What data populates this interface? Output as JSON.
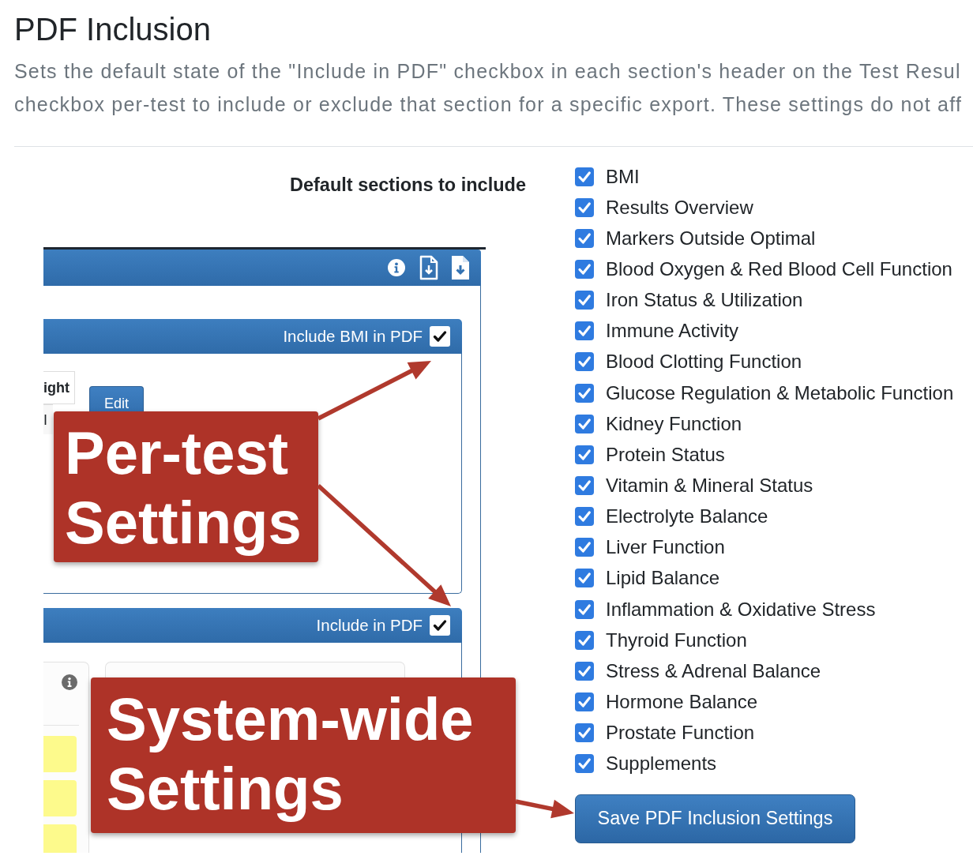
{
  "page": {
    "title": "PDF Inclusion",
    "description_lines": [
      "Sets the default state of the \"Include in PDF\" checkbox in each section's header on the Test Resul",
      "checkbox per-test to include or exclude that section for a specific export. These settings do not aff"
    ]
  },
  "settings": {
    "label": "Default sections to include",
    "sections": [
      {
        "label": "BMI",
        "checked": true
      },
      {
        "label": "Results Overview",
        "checked": true
      },
      {
        "label": "Markers Outside Optimal",
        "checked": true
      },
      {
        "label": "Blood Oxygen & Red Blood Cell Function",
        "checked": true
      },
      {
        "label": "Iron Status & Utilization",
        "checked": true
      },
      {
        "label": "Immune Activity",
        "checked": true
      },
      {
        "label": "Blood Clotting Function",
        "checked": true
      },
      {
        "label": "Glucose Regulation & Metabolic Function",
        "checked": true
      },
      {
        "label": "Kidney Function",
        "checked": true
      },
      {
        "label": "Protein Status",
        "checked": true
      },
      {
        "label": "Vitamin & Mineral Status",
        "checked": true
      },
      {
        "label": "Electrolyte Balance",
        "checked": true
      },
      {
        "label": "Liver Function",
        "checked": true
      },
      {
        "label": "Lipid Balance",
        "checked": true
      },
      {
        "label": "Inflammation & Oxidative Stress",
        "checked": true
      },
      {
        "label": "Thyroid Function",
        "checked": true
      },
      {
        "label": "Stress & Adrenal Balance",
        "checked": true
      },
      {
        "label": "Hormone Balance",
        "checked": true
      },
      {
        "label": "Prostate Function",
        "checked": true
      },
      {
        "label": "Supplements",
        "checked": true
      }
    ],
    "save_button": "Save PDF Inclusion Settings"
  },
  "inset": {
    "panels": [
      {
        "kind": "table",
        "header_label": "Include BMI in PDF",
        "checked": true,
        "cells": [
          "ight",
          "I"
        ],
        "button": "Edit"
      },
      {
        "kind": "cards",
        "header_label": "Include in PDF",
        "checked": true
      }
    ]
  },
  "callouts": [
    {
      "lines": [
        "Per-test",
        "Settings"
      ]
    },
    {
      "lines": [
        "System-wide",
        "Settings"
      ]
    }
  ]
}
